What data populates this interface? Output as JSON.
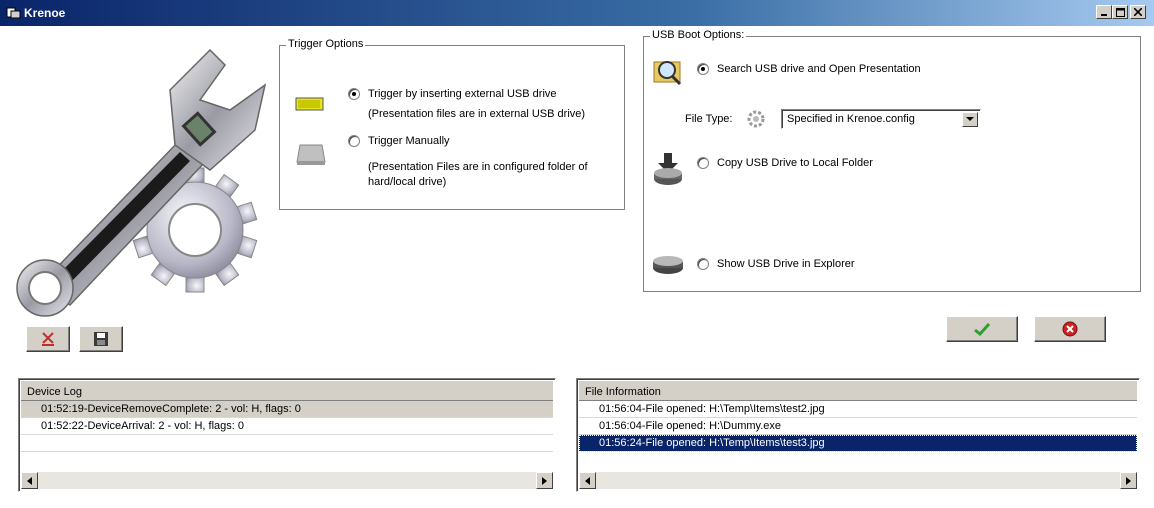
{
  "window": {
    "title": "Krenoe"
  },
  "trigger": {
    "title": "Trigger Options",
    "option1": {
      "label": "Trigger by inserting external USB drive",
      "note": "(Presentation files are in external USB drive)",
      "selected": true
    },
    "option2": {
      "label": "Trigger Manually",
      "note_line1": "(Presentation Files are in configured folder of",
      "note_line2": "hard/local drive)",
      "selected": false
    }
  },
  "usb": {
    "title": "USB Boot Options:",
    "search_label": "Search USB drive and Open Presentation",
    "filetype_label": "File Type:",
    "filetype_value": "Specified in Krenoe.config",
    "copy_label": "Copy USB Drive to Local Folder",
    "explorer_label": "Show USB Drive in Explorer"
  },
  "device_log": {
    "header": "Device Log",
    "rows": [
      {
        "text": "01:52:19-DeviceRemoveComplete: 2 - vol: H, flags: 0"
      },
      {
        "text": "01:52:22-DeviceArrival: 2 - vol: H, flags: 0"
      }
    ]
  },
  "file_info": {
    "header": "File Information",
    "rows": [
      {
        "text": "01:56:04-File opened: H:\\Temp\\Items\\test2.jpg"
      },
      {
        "text": "01:56:04-File opened: H:\\Dummy.exe"
      },
      {
        "text": "01:56:24-File opened: H:\\Temp\\Items\\test3.jpg"
      }
    ],
    "selected_index": 2
  },
  "colors": {
    "title_gradient_start": "#0a246a",
    "title_gradient_end": "#a6caf0",
    "selection": "#0a246a",
    "ok_green": "#2e9e2e",
    "cancel_red": "#cc2222"
  },
  "icons": [
    "krenoe-app-icon",
    "wrench-gear-graphic",
    "usb-drive-icon",
    "hard-drive-icon",
    "search-folder-icon",
    "gear-small-icon",
    "download-drive-icon",
    "drive-icon",
    "clear-icon",
    "save-icon",
    "ok-check-icon",
    "cancel-icon"
  ]
}
